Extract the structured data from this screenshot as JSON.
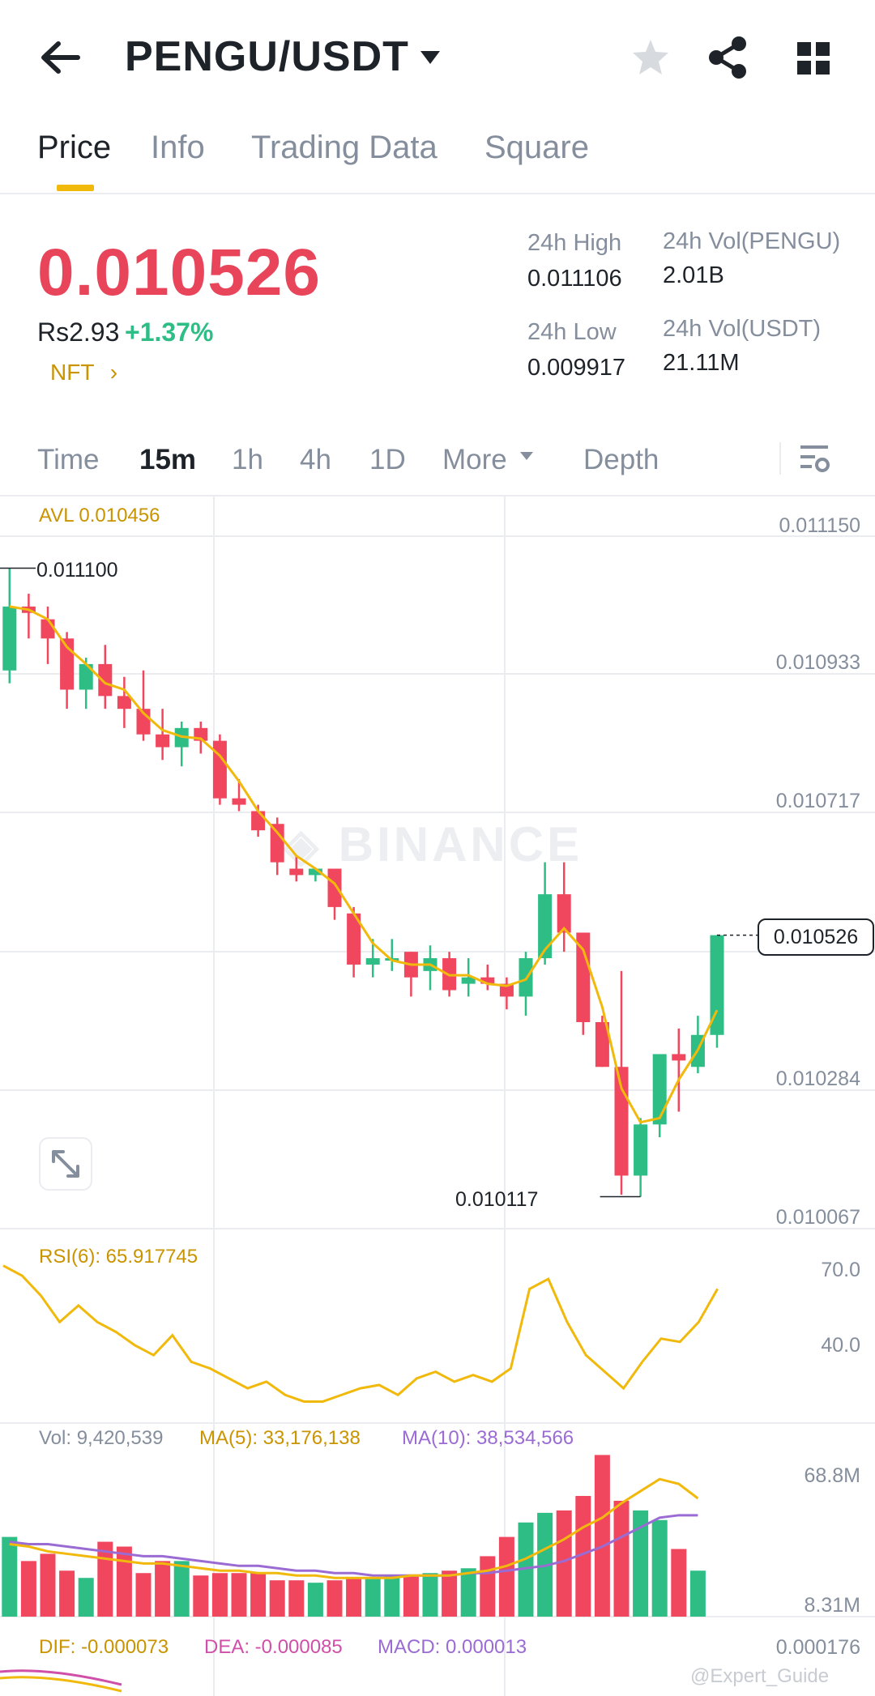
{
  "header": {
    "title": "PENGU/USDT"
  },
  "tabs": [
    {
      "label": "Price",
      "active": true
    },
    {
      "label": "Info"
    },
    {
      "label": "Trading Data"
    },
    {
      "label": "Square"
    }
  ],
  "ticker": {
    "last_price": "0.010526",
    "fiat_price": "Rs2.93",
    "change": "+1.37%",
    "tag": "NFT",
    "high_label": "24h High",
    "high": "0.011106",
    "low_label": "24h Low",
    "low": "0.009917",
    "vol_base_label": "24h Vol(PENGU)",
    "vol_base": "2.01B",
    "vol_quote_label": "24h Vol(USDT)",
    "vol_quote": "21.11M"
  },
  "timeframes": [
    "Time",
    "15m",
    "1h",
    "4h",
    "1D",
    "More",
    "Depth"
  ],
  "active_timeframe": "15m",
  "watermark": "BINANCE",
  "chart": {
    "avl": "AVL 0.010456",
    "price_axis": [
      "0.011150",
      "0.010933",
      "0.010717",
      "0.010284",
      "0.010067"
    ],
    "max_label": "0.011100",
    "min_label": "0.010117",
    "current_label": "0.010526",
    "rsi_label": "RSI(6): 65.917745",
    "rsi_axis": [
      "70.0",
      "40.0"
    ],
    "vol_label": "Vol: 9,420,539",
    "ma5_label": "MA(5): 33,176,138",
    "ma10_label": "MA(10): 38,534,566",
    "vol_axis": [
      "68.8M",
      "8.31M"
    ],
    "dif_label": "DIF: -0.000073",
    "dea_label": "DEA: -0.000085",
    "macd_label": "MACD: 0.000013",
    "macd_axis": "0.000176",
    "credit": "@Expert_Guide"
  },
  "colors": {
    "up": "#2ebd85",
    "down": "#f0475e",
    "accent": "#f0b90b",
    "ma10": "#9b6bd4"
  },
  "chart_data": {
    "type": "candlestick",
    "ylim": [
      0.010067,
      0.01115
    ],
    "candles": [
      {
        "o": 0.01094,
        "h": 0.0111,
        "l": 0.01092,
        "c": 0.01104
      },
      {
        "o": 0.01104,
        "h": 0.01106,
        "l": 0.01099,
        "c": 0.01103
      },
      {
        "o": 0.01102,
        "h": 0.01104,
        "l": 0.01095,
        "c": 0.01099
      },
      {
        "o": 0.01099,
        "h": 0.011,
        "l": 0.01088,
        "c": 0.01091
      },
      {
        "o": 0.01091,
        "h": 0.01096,
        "l": 0.01088,
        "c": 0.01095
      },
      {
        "o": 0.01095,
        "h": 0.01098,
        "l": 0.01088,
        "c": 0.0109
      },
      {
        "o": 0.0109,
        "h": 0.01093,
        "l": 0.01085,
        "c": 0.01088
      },
      {
        "o": 0.01088,
        "h": 0.01094,
        "l": 0.01083,
        "c": 0.01084
      },
      {
        "o": 0.01084,
        "h": 0.01088,
        "l": 0.0108,
        "c": 0.01082
      },
      {
        "o": 0.01082,
        "h": 0.01086,
        "l": 0.01079,
        "c": 0.01085
      },
      {
        "o": 0.01085,
        "h": 0.01086,
        "l": 0.01081,
        "c": 0.01083
      },
      {
        "o": 0.01083,
        "h": 0.01084,
        "l": 0.01073,
        "c": 0.01074
      },
      {
        "o": 0.01074,
        "h": 0.01077,
        "l": 0.01072,
        "c": 0.01073
      },
      {
        "o": 0.01072,
        "h": 0.01073,
        "l": 0.01068,
        "c": 0.01069
      },
      {
        "o": 0.0107,
        "h": 0.01071,
        "l": 0.01062,
        "c": 0.01064
      },
      {
        "o": 0.01063,
        "h": 0.01065,
        "l": 0.01061,
        "c": 0.01062
      },
      {
        "o": 0.01062,
        "h": 0.01063,
        "l": 0.01061,
        "c": 0.01063
      },
      {
        "o": 0.01063,
        "h": 0.01063,
        "l": 0.01055,
        "c": 0.01057
      },
      {
        "o": 0.01056,
        "h": 0.01057,
        "l": 0.01046,
        "c": 0.01048
      },
      {
        "o": 0.01048,
        "h": 0.01052,
        "l": 0.01046,
        "c": 0.01049
      },
      {
        "o": 0.01049,
        "h": 0.01052,
        "l": 0.01047,
        "c": 0.01049
      },
      {
        "o": 0.0105,
        "h": 0.0105,
        "l": 0.01043,
        "c": 0.01046
      },
      {
        "o": 0.01047,
        "h": 0.01051,
        "l": 0.01044,
        "c": 0.01049
      },
      {
        "o": 0.01049,
        "h": 0.0105,
        "l": 0.01043,
        "c": 0.01044
      },
      {
        "o": 0.01045,
        "h": 0.01049,
        "l": 0.01043,
        "c": 0.01046
      },
      {
        "o": 0.01046,
        "h": 0.01048,
        "l": 0.01044,
        "c": 0.01045
      },
      {
        "o": 0.01045,
        "h": 0.01046,
        "l": 0.01041,
        "c": 0.01043
      },
      {
        "o": 0.01043,
        "h": 0.0105,
        "l": 0.0104,
        "c": 0.01049
      },
      {
        "o": 0.01049,
        "h": 0.01064,
        "l": 0.01048,
        "c": 0.01059
      },
      {
        "o": 0.01059,
        "h": 0.01064,
        "l": 0.0105,
        "c": 0.01053
      },
      {
        "o": 0.01053,
        "h": 0.01053,
        "l": 0.01037,
        "c": 0.01039
      },
      {
        "o": 0.01039,
        "h": 0.0104,
        "l": 0.01032,
        "c": 0.01032
      },
      {
        "o": 0.01032,
        "h": 0.01047,
        "l": 0.01012,
        "c": 0.01015
      },
      {
        "o": 0.01015,
        "h": 0.01024,
        "l": 0.010117,
        "c": 0.01023
      },
      {
        "o": 0.01023,
        "h": 0.01034,
        "l": 0.01021,
        "c": 0.01034
      },
      {
        "o": 0.01034,
        "h": 0.01038,
        "l": 0.01025,
        "c": 0.01033
      },
      {
        "o": 0.01032,
        "h": 0.0104,
        "l": 0.01031,
        "c": 0.01037
      },
      {
        "o": 0.01037,
        "h": 0.010526,
        "l": 0.01035,
        "c": 0.010526
      }
    ],
    "rsi": [
      67,
      64,
      58,
      50,
      55,
      50,
      47,
      43,
      40,
      46,
      38,
      36,
      33,
      30,
      32,
      28,
      26,
      26,
      28,
      30,
      31,
      28,
      33,
      35,
      32,
      34,
      32,
      36,
      60,
      63,
      50,
      40,
      35,
      30,
      38,
      45,
      44,
      50,
      60
    ],
    "volume": {
      "ylim": [
        8.31,
        68.8
      ],
      "values": [
        36,
        26,
        29,
        22,
        19,
        34,
        32,
        21,
        26,
        26,
        20,
        21,
        21,
        21,
        18,
        18,
        17,
        18,
        19,
        19,
        20,
        20,
        21,
        22,
        23,
        28,
        36,
        42,
        46,
        47,
        53,
        70,
        51,
        47,
        43,
        31,
        22
      ]
    },
    "ma5": [
      33,
      32,
      30,
      29,
      28,
      27,
      26,
      25,
      25,
      24,
      23,
      22,
      22,
      21,
      21,
      20,
      20,
      19,
      19,
      19,
      19,
      20,
      20,
      20,
      21,
      22,
      24,
      27,
      31,
      35,
      40,
      44,
      50,
      55,
      60,
      58,
      52
    ],
    "ma10": [
      34,
      33,
      33,
      32,
      31,
      30,
      29,
      28,
      28,
      27,
      26,
      25,
      24,
      24,
      23,
      22,
      22,
      21,
      21,
      20,
      20,
      20,
      20,
      20,
      21,
      21,
      22,
      23,
      24,
      26,
      29,
      32,
      36,
      40,
      44,
      45,
      45
    ]
  }
}
